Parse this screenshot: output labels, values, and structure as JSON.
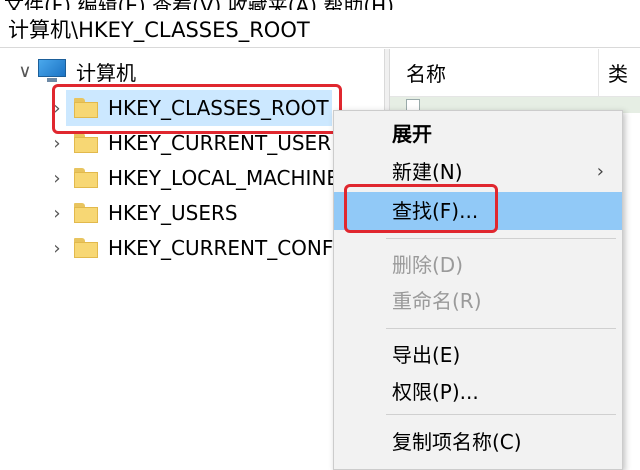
{
  "menubar": {
    "partial_text": "文件(F)   编辑(E)   查看(V)   收藏夹(A)   帮助(H)"
  },
  "address": {
    "path": "计算机\\HKEY_CLASSES_ROOT"
  },
  "tree": {
    "root": {
      "label": "计算机",
      "icon": "computer-icon",
      "expand_glyph": "∨"
    },
    "items": [
      {
        "label": "HKEY_CLASSES_ROOT",
        "selected": true
      },
      {
        "label": "HKEY_CURRENT_USER"
      },
      {
        "label": "HKEY_LOCAL_MACHINE"
      },
      {
        "label": "HKEY_USERS"
      },
      {
        "label": "HKEY_CURRENT_CONFIG"
      }
    ],
    "collapsed_glyph": "›"
  },
  "list": {
    "columns": [
      "名称",
      "类"
    ]
  },
  "context_menu": {
    "items": [
      {
        "label": "展开",
        "bold": true
      },
      {
        "label": "新建(N)",
        "has_submenu": true,
        "arrow": "›"
      },
      {
        "label": "查找(F)...",
        "hover": true
      },
      {
        "label": "删除(D)",
        "disabled": true
      },
      {
        "label": "重命名(R)",
        "disabled": true
      },
      {
        "label": "导出(E)"
      },
      {
        "label": "权限(P)..."
      },
      {
        "label": "复制项名称(C)"
      }
    ]
  },
  "colors": {
    "selection": "#cce8ff",
    "menu_hover": "#91c9f7",
    "highlight_box": "#e0272f",
    "folder": "#f7d774"
  }
}
